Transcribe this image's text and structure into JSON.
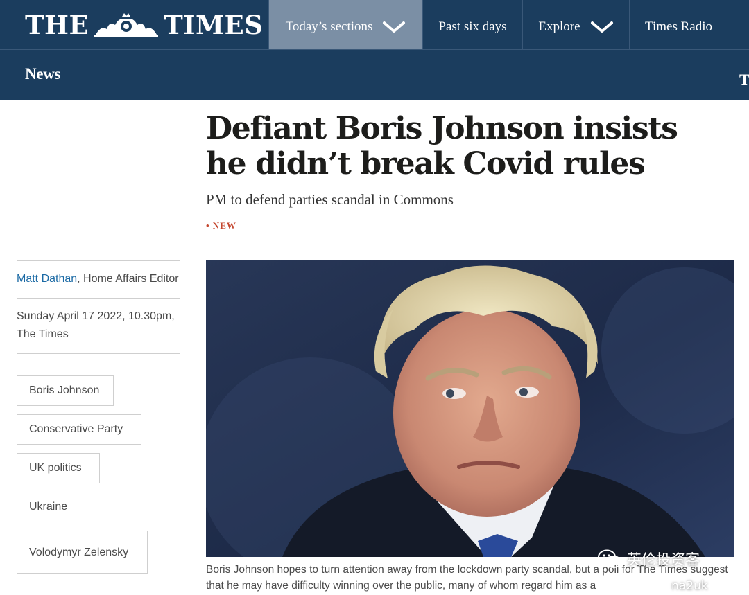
{
  "masthead": {
    "logo_left": "THE",
    "logo_right": "TIMES",
    "crest_icon": "royal-crest-icon"
  },
  "nav": {
    "items": [
      {
        "label": "Today’s sections",
        "has_dropdown": true,
        "active": true
      },
      {
        "label": "Past six days",
        "has_dropdown": false,
        "active": false
      },
      {
        "label": "Explore",
        "has_dropdown": true,
        "active": false
      },
      {
        "label": "Times Radio",
        "has_dropdown": false,
        "active": false
      }
    ],
    "section": "News",
    "edge_glyph": "T"
  },
  "article": {
    "headline": "Defiant Boris Johnson insists he didn’t break Covid rules",
    "standfirst": "PM to defend parties scandal in Commons",
    "flag": "• NEW",
    "author": "Matt Dathan",
    "author_role": ", Home Affairs Editor",
    "dateline": "Sunday April 17 2022, 10.30pm, The Times",
    "tags": [
      "Boris Johnson",
      "Conservative Party",
      "UK politics",
      "Ukraine",
      "Volodymyr Zelensky"
    ],
    "caption": "Boris Johnson hopes to turn attention away from the lockdown party scandal, but a poll for The Times suggest that he may have difficulty winning over the public, many of whom regard him as a"
  },
  "watermark": {
    "text": "英伦投资客",
    "handle": "na2uk",
    "icon": "wechat-icon"
  },
  "colors": {
    "nav_bg": "#1b3d5e",
    "nav_active_bg": "#7b8fa5",
    "author_link": "#1b6aa5",
    "new_flag": "#c4462e"
  }
}
